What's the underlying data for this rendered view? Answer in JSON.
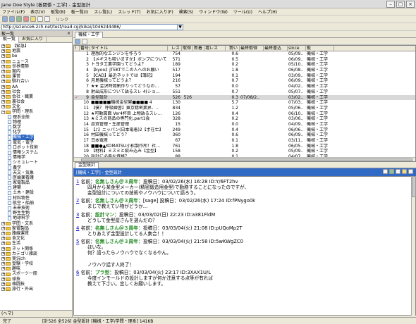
{
  "window": {
    "title": "Jane Doe Style [板関係・工学] - 金型設計"
  },
  "menu": [
    "ファイル(F)",
    "表示(V)",
    "板覧(B)",
    "板一覧(I)",
    "スレ覧(L)",
    "スレッド(T)",
    "お気に入り(F)",
    "検索(S)",
    "ウィンドウ(W)",
    "ツール(U)",
    "ヘルプ(H)"
  ],
  "toolbar": {
    "link_label": "リンク"
  },
  "url": {
    "value": "http://science6.2ch.net/test/read.cgi/kikai/1046244486/"
  },
  "left_panel": {
    "title": "板一覧",
    "tabs": [
      "板一覧",
      "お気に入り"
    ],
    "tree": [
      {
        "label": "【緊急】",
        "kind": "folder",
        "depth": 0
      },
      {
        "label": "地震",
        "kind": "folder",
        "depth": 0
      },
      {
        "label": "be",
        "kind": "folder",
        "depth": 0
      },
      {
        "label": "ニュース",
        "kind": "folder",
        "depth": 0
      },
      {
        "label": "世界情勢",
        "kind": "folder",
        "depth": 0
      },
      {
        "label": "案内",
        "kind": "folder",
        "depth": 0
      },
      {
        "label": "運営",
        "kind": "folder",
        "depth": 0
      },
      {
        "label": "馴れ合い",
        "kind": "folder",
        "depth": 0
      },
      {
        "label": "AA",
        "kind": "folder",
        "depth": 0
      },
      {
        "label": "社会",
        "kind": "folder",
        "depth": 0
      },
      {
        "label": "会社・職業",
        "kind": "folder",
        "depth": 0
      },
      {
        "label": "裏社会",
        "kind": "folder",
        "depth": 0
      },
      {
        "label": "文化",
        "kind": "folder",
        "depth": 0
      },
      {
        "label": "学問・理系",
        "kind": "folder-open",
        "depth": 0
      },
      {
        "label": "理系全般",
        "kind": "board",
        "depth": 1
      },
      {
        "label": "物理",
        "kind": "board",
        "depth": 1
      },
      {
        "label": "数学",
        "kind": "board",
        "depth": 1
      },
      {
        "label": "化学",
        "kind": "board",
        "depth": 1
      },
      {
        "label": "機械・工学",
        "kind": "board",
        "depth": 1,
        "selected": true
      },
      {
        "label": "電気・電子",
        "kind": "board",
        "depth": 1
      },
      {
        "label": "ロボット技術",
        "kind": "board",
        "depth": 1
      },
      {
        "label": "情報システム",
        "kind": "board",
        "depth": 1
      },
      {
        "label": "情報学",
        "kind": "board",
        "depth": 1
      },
      {
        "label": "シミュレート",
        "kind": "board",
        "depth": 1
      },
      {
        "label": "農学",
        "kind": "board",
        "depth": 1
      },
      {
        "label": "天文・気象",
        "kind": "board",
        "depth": 1
      },
      {
        "label": "医歯薬看護",
        "kind": "board",
        "depth": 1
      },
      {
        "label": "家電製品",
        "kind": "board",
        "depth": 1
      },
      {
        "label": "建築",
        "kind": "board",
        "depth": 1
      },
      {
        "label": "土木・建設",
        "kind": "board",
        "depth": 1
      },
      {
        "label": "材料物性",
        "kind": "board",
        "depth": 1
      },
      {
        "label": "航空・船舶",
        "kind": "board",
        "depth": 1
      },
      {
        "label": "未来技術",
        "kind": "board",
        "depth": 1
      },
      {
        "label": "野生生物",
        "kind": "board",
        "depth": 1
      },
      {
        "label": "地球科学",
        "kind": "board",
        "depth": 1
      },
      {
        "label": "学問・文系",
        "kind": "folder",
        "depth": 0
      },
      {
        "label": "家電製品",
        "kind": "folder",
        "depth": 0
      },
      {
        "label": "路線運賃",
        "kind": "folder",
        "depth": 0
      },
      {
        "label": "食文化",
        "kind": "folder",
        "depth": 0
      },
      {
        "label": "生活",
        "kind": "folder",
        "depth": 0
      },
      {
        "label": "ネット関係",
        "kind": "folder",
        "depth": 0
      },
      {
        "label": "カテゴリ雑談",
        "kind": "folder",
        "depth": 0
      },
      {
        "label": "実況ch",
        "kind": "folder",
        "depth": 0
      },
      {
        "label": "受験・学校",
        "kind": "folder",
        "depth": 0
      },
      {
        "label": "趣味",
        "kind": "folder",
        "depth": 0
      },
      {
        "label": "スポーツ一般",
        "kind": "folder",
        "depth": 0
      },
      {
        "label": "球技",
        "kind": "folder",
        "depth": 0
      },
      {
        "label": "格闘技",
        "kind": "folder",
        "depth": 0
      },
      {
        "label": "旅行・外出",
        "kind": "folder",
        "depth": 0
      }
    ],
    "status": "(ヘマ)"
  },
  "board_tab": "機械・工学",
  "thread_list": {
    "columns": [
      "!",
      "番号",
      "タイトル",
      "レス",
      "取得",
      "新着",
      "増レス",
      "勢い",
      "最終取得",
      "最終書込",
      "since",
      "板"
    ],
    "rows": [
      {
        "mark": "",
        "num": "1",
        "title": "理想的なエンジンを作ろう",
        "res": "754",
        "got": "",
        "new": "",
        "inc": "",
        "speed": "0.6",
        "last_get": "",
        "last_write": "",
        "since": "05/09..",
        "board": "機械・工学"
      },
      {
        "mark": "",
        "num": "2",
        "title": "【メギスも吸いますか】ポンプについて",
        "res": "571",
        "got": "",
        "new": "",
        "inc": "",
        "speed": "0.5",
        "last_get": "",
        "last_write": "",
        "since": "06/09..",
        "board": "機械・工学"
      },
      {
        "mark": "",
        "num": "3",
        "title": "トヨタ工業学園ってどうよ？",
        "res": "189",
        "got": "",
        "new": "",
        "inc": "",
        "speed": "0.2",
        "last_get": "",
        "last_write": "",
        "since": "05/10..",
        "board": "機械・工学"
      },
      {
        "mark": "",
        "num": "4",
        "title": "【kyoo】JTEKTでこの人へのお願い",
        "res": "517",
        "got": "",
        "new": "",
        "inc": "",
        "speed": "1.8",
        "last_get": "",
        "last_write": "",
        "since": "06/08..",
        "board": "機械・工学"
      },
      {
        "mark": "",
        "num": "5",
        "title": "【CAD】最近ネットでは【簿記】",
        "res": "194",
        "got": "",
        "new": "",
        "inc": "",
        "speed": "0.1",
        "last_get": "",
        "last_write": "",
        "since": "03/09..",
        "board": "機械・工学"
      },
      {
        "mark": "",
        "num": "6",
        "title": "月島機械ってどうよ？",
        "res": "216",
        "got": "",
        "new": "",
        "inc": "",
        "speed": "0.7",
        "last_get": "",
        "last_write": "",
        "since": "06/09..",
        "board": "機械・工学"
      },
      {
        "mark": "",
        "num": "7",
        "title": "★★ 金沢時間割作りってどうなの…",
        "res": "57",
        "got": "",
        "new": "",
        "inc": "",
        "speed": "0.0",
        "last_get": "",
        "last_write": "",
        "since": "04/02..",
        "board": "機械・工学"
      },
      {
        "mark": "",
        "num": "8",
        "title": "射出成形について語るスレ 4(ショ…",
        "res": "551",
        "got": "",
        "new": "",
        "inc": "",
        "speed": "0.7",
        "last_get": "",
        "last_write": "",
        "since": "05/07..",
        "board": "機械・工学"
      },
      {
        "mark": "✓",
        "num": "9",
        "title": "金型設計",
        "res": "526",
        "got": "526",
        "new": "",
        "inc": "",
        "speed": "0.3",
        "last_get": "07/08/2..",
        "last_write": "",
        "since": "03/02..",
        "board": "機械・工学",
        "selected": true
      },
      {
        "mark": "",
        "num": "10",
        "title": "■■■■■機械金型屋■■■■ 4",
        "res": "130",
        "got": "",
        "new": "",
        "inc": "",
        "speed": "5.7",
        "last_get": "",
        "last_write": "",
        "since": "07/03..",
        "board": "機械・工学"
      },
      {
        "mark": "",
        "num": "11",
        "title": "【僕？ 呼吸練習】東京精密業界、..",
        "res": "834",
        "got": "",
        "new": "",
        "inc": "",
        "speed": "1.2",
        "last_get": "",
        "last_write": "",
        "since": "05/06..",
        "board": "機械・工学"
      },
      {
        "mark": "",
        "num": "12",
        "title": "★可動図面 Ver4杯目 上物語るスレ…",
        "res": "126",
        "got": "",
        "new": "",
        "inc": "",
        "speed": "0.4",
        "last_get": "",
        "last_write": "",
        "since": "06/10..",
        "board": "機械・工学"
      },
      {
        "mark": "",
        "num": "13",
        "title": "★ミスの商品の専門化.part1会",
        "res": "328",
        "got": "",
        "new": "",
        "inc": "",
        "speed": "0.2",
        "last_get": "",
        "last_write": "",
        "since": "03/06..",
        "board": "機械・工学"
      },
      {
        "mark": "",
        "num": "14",
        "title": "品質管理・生産管理",
        "res": "15",
        "got": "",
        "new": "",
        "inc": "",
        "speed": "0.0",
        "last_get": "",
        "last_write": "",
        "since": "04/09..",
        "board": "機械・工学"
      },
      {
        "mark": "",
        "num": "15",
        "title": "【♪】ニッパン(日本電着)2【ポ在亡】",
        "res": "249",
        "got": "",
        "new": "",
        "inc": "",
        "speed": "0.4",
        "last_get": "",
        "last_write": "",
        "since": "06/06..",
        "board": "機械・工学"
      },
      {
        "mark": "",
        "num": "16",
        "title": "村田機械ってどう？",
        "res": "360",
        "got": "",
        "new": "",
        "inc": "",
        "speed": "0.6",
        "last_get": "",
        "last_write": "",
        "since": "06/09..",
        "board": "機械・工学"
      },
      {
        "mark": "",
        "num": "17",
        "title": "日本電産",
        "res": "67",
        "got": "",
        "new": "",
        "inc": "",
        "speed": "0.1",
        "last_get": "",
        "last_write": "",
        "since": "03/11..",
        "board": "機械・工学"
      },
      {
        "mark": "",
        "num": "18",
        "title": "■■●▲KOMATSU小松製作所！社…",
        "res": "761",
        "got": "",
        "new": "",
        "inc": "",
        "speed": "1.8",
        "last_get": "",
        "last_write": "",
        "since": "06/05..",
        "board": "機械・工学"
      },
      {
        "mark": "",
        "num": "19",
        "title": "【材料】ミスミと飲み込み【金型】",
        "res": "158",
        "got": "",
        "new": "",
        "inc": "",
        "speed": "0.2",
        "last_get": "",
        "last_write": "",
        "since": "05/09..",
        "board": "機械・工学"
      },
      {
        "mark": "",
        "num": "20",
        "title": "設計に必要な資格？",
        "res": "88",
        "got": "",
        "new": "",
        "inc": "",
        "speed": "0.1",
        "last_get": "",
        "last_write": "",
        "since": "04/07..",
        "board": "機械・工学"
      }
    ]
  },
  "viewer": {
    "tab": "金型設計",
    "header": "[機械・工学] - 金型設計",
    "posts": [
      {
        "num": "1",
        "name": "名無しさん＠３周年",
        "sep": "：",
        "meta": "投稿日：03/02/26(水) 16:28 ID:Y/6FT2hv",
        "named_style": "green",
        "body": [
          "四月から某金型メーカー(精密鍛造用金型)で勤務することになったのですが、",
          "金型設計についての技術やノウハウについて語ろう。"
        ]
      },
      {
        "num": "2",
        "name": "名無しさん＠３周年",
        "sep": "：",
        "meta": "[sage] 投稿日：03/02/26(水) 17:24 ID:fPNygo0k",
        "named_style": "green",
        "body": [
          "まじで教えてい物がどうか…"
        ]
      },
      {
        "num": "3",
        "name": "設計マン",
        "sep": "：",
        "meta": "投稿日：03/03/02(日) 22:23 ID:a381FldM",
        "named_style": "green",
        "body": [
          "どうして金型屋さんを選んだの？"
        ]
      },
      {
        "num": "4",
        "name": "名無しさん＠３周年",
        "sep": "：",
        "meta": "投稿日：03/03/04(火) 21:08 ID:pUQoMp2T",
        "named_style": "green",
        "body": [
          "とりあえず金型設計してる人集合！！"
        ]
      },
      {
        "num": "5",
        "name": "名無しさん＠３周年",
        "sep": "：",
        "meta": "投稿日：03/03/04(火) 21:58 ID:5wKWgZC0",
        "named_style": "green",
        "body": [
          "ほいな。",
          "何？語ったらノウハウでなくなるやん。",
          "",
          "ノウハウ話す人終了！"
        ]
      },
      {
        "num": "6",
        "name": "プラ型",
        "sep": "：",
        "meta": "投稿日：03/03/04(火) 23:17 ID:3XAX1U/L",
        "named_style": "green",
        "body": [
          "今度インモールドの設計しますが何か注意する点等が有れば",
          "教えて下さい。宜しくお願いします。"
        ]
      }
    ]
  },
  "statusbar": {
    "left": "完了",
    "right": "[計526 全526] 金型設計 [機械・工学/学問・理系] 141KB"
  }
}
